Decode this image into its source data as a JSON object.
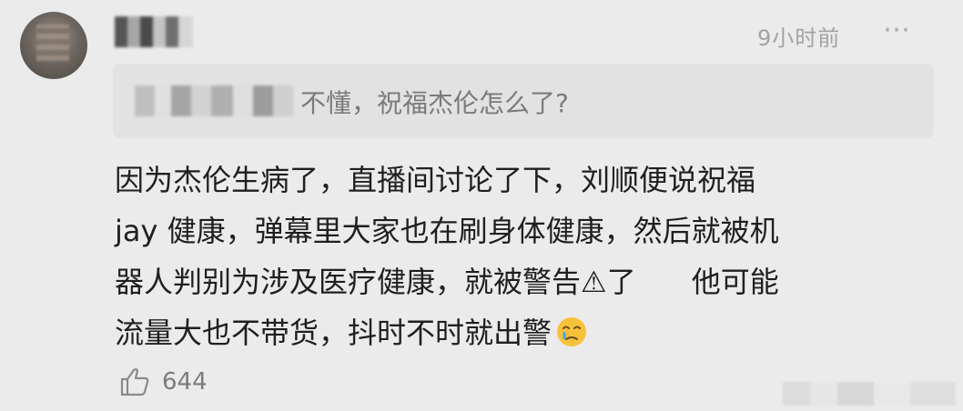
{
  "comment": {
    "time": "9小时前",
    "more_icon": "⋯",
    "quote_text": "不懂，祝福杰伦怎么了?",
    "lines": [
      "因为杰伦生病了，直播间讨论了下，刘顺便说祝福",
      "jay 健康，弹幕里大家也在刷身体健康，然后就被机",
      "器人判别为涉及医疗健康，就被警告⚠了      他可能",
      "流量大也不带货，抖时不时就出警"
    ],
    "emoji": "crying-face-icon",
    "like_count": "644"
  },
  "colors": {
    "background": "#ebebeb",
    "quote_background": "#e2e2e2",
    "muted_text": "#a3a3a3"
  }
}
